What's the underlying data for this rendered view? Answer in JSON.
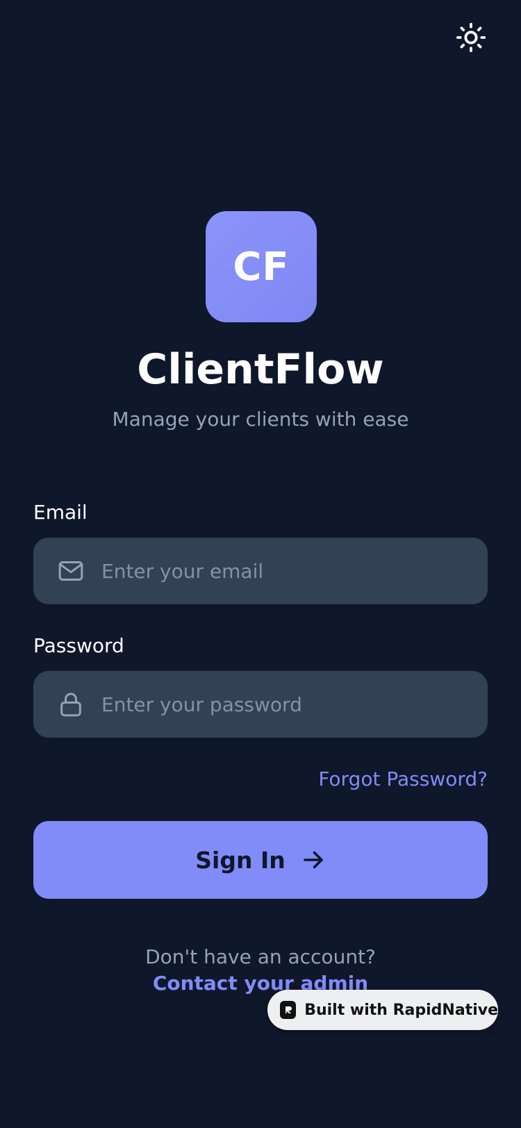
{
  "header": {
    "theme_toggle_icon": "sun-icon"
  },
  "brand": {
    "logo_initials": "CF",
    "logo_color": "#818cf8",
    "title": "ClientFlow",
    "subtitle": "Manage your clients with ease"
  },
  "form": {
    "email": {
      "label": "Email",
      "placeholder": "Enter your email",
      "value": "",
      "icon": "mail-icon"
    },
    "password": {
      "label": "Password",
      "placeholder": "Enter your password",
      "value": "",
      "icon": "lock-icon"
    },
    "forgot_label": "Forgot Password?",
    "submit": {
      "label": "Sign In",
      "icon": "arrow-right-icon"
    }
  },
  "footer": {
    "prompt": "Don't have an account?",
    "link": "Contact your admin"
  },
  "badge": {
    "label": "Built with RapidNative",
    "icon": "rapidnative-logo"
  },
  "colors": {
    "background": "#0f172a",
    "input_background": "#334155",
    "accent": "#818cf8",
    "muted_text": "#94a3b8"
  }
}
